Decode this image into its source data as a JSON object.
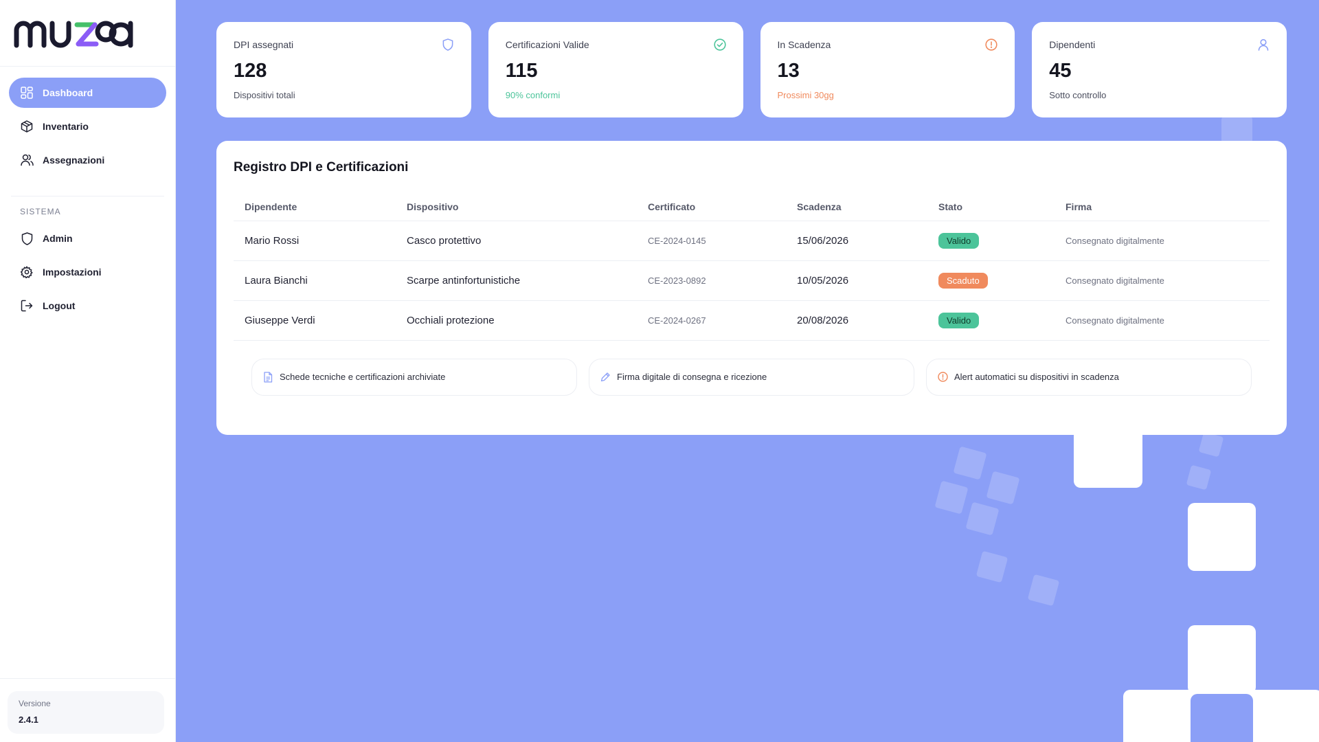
{
  "app": {
    "logo_text": "muza"
  },
  "sidebar": {
    "items": [
      {
        "label": "Dashboard",
        "icon": "dashboard-grid-icon",
        "active": true
      },
      {
        "label": "Inventario",
        "icon": "box-icon",
        "active": false
      },
      {
        "label": "Assegnazioni",
        "icon": "users-icon",
        "active": false
      }
    ],
    "section_label": "SISTEMA",
    "system_items": [
      {
        "label": "Admin",
        "icon": "shield-icon"
      },
      {
        "label": "Impostazioni",
        "icon": "gear-icon"
      },
      {
        "label": "Logout",
        "icon": "logout-icon"
      }
    ],
    "version": {
      "label": "Versione",
      "value": "2.4.1"
    }
  },
  "stats": [
    {
      "label": "DPI assegnati",
      "value": "128",
      "sub": "Dispositivi totali",
      "icon": "shield-icon",
      "tone": "neutral"
    },
    {
      "label": "Certificazioni Valide",
      "value": "115",
      "sub": "90% conformi",
      "icon": "check-circle-icon",
      "tone": "green"
    },
    {
      "label": "In Scadenza",
      "value": "13",
      "sub": "Prossimi 30gg",
      "icon": "alert-circle-icon",
      "tone": "orange"
    },
    {
      "label": "Dipendenti",
      "value": "45",
      "sub": "Sotto controllo",
      "icon": "user-icon",
      "tone": "neutral"
    }
  ],
  "registry": {
    "title": "Registro DPI e Certificazioni",
    "columns": [
      "Dipendente",
      "Dispositivo",
      "Certificato",
      "Scadenza",
      "Stato",
      "Firma"
    ],
    "rows": [
      {
        "employee": "Mario Rossi",
        "device": "Casco protettivo",
        "certificate": "CE-2024-0145",
        "expiry": "15/06/2026",
        "status": "Valido",
        "signature": "Consegnato digitalmente"
      },
      {
        "employee": "Laura Bianchi",
        "device": "Scarpe antinfortunistiche",
        "certificate": "CE-2023-0892",
        "expiry": "10/05/2026",
        "status": "Scaduto",
        "signature": "Consegnato digitalmente"
      },
      {
        "employee": "Giuseppe Verdi",
        "device": "Occhiali protezione",
        "certificate": "CE-2024-0267",
        "expiry": "20/08/2026",
        "status": "Valido",
        "signature": "Consegnato digitalmente"
      }
    ],
    "features": [
      {
        "label": "Schede tecniche e certificazioni archiviate",
        "icon": "document-icon"
      },
      {
        "label": "Firma digitale di consegna e ricezione",
        "icon": "pen-icon"
      },
      {
        "label": "Alert automatici su dispositivi in scadenza",
        "icon": "alert-circle-icon"
      }
    ]
  },
  "colors": {
    "background": "#8b9ff7",
    "accent": "#8b9ff7",
    "success": "#4cc49a",
    "warning": "#f08a5d"
  }
}
